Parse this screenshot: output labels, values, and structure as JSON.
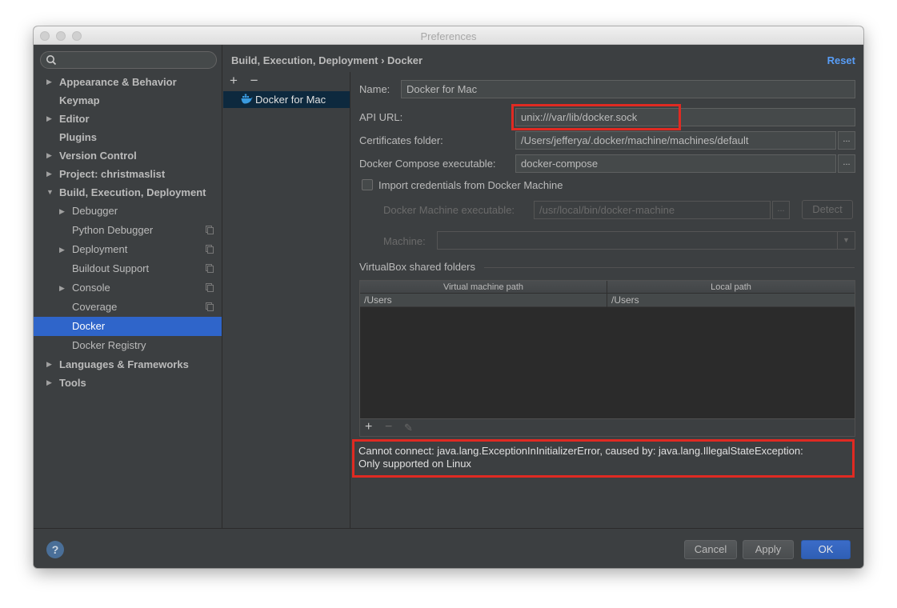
{
  "window": {
    "title": "Preferences"
  },
  "sidebar": {
    "search_placeholder": "",
    "items": [
      {
        "label": "Appearance & Behavior",
        "arrow": "▶",
        "bold": true
      },
      {
        "label": "Keymap",
        "arrow": "",
        "bold": true
      },
      {
        "label": "Editor",
        "arrow": "▶",
        "bold": true
      },
      {
        "label": "Plugins",
        "arrow": "",
        "bold": true
      },
      {
        "label": "Version Control",
        "arrow": "▶",
        "bold": true
      },
      {
        "label": "Project: christmaslist",
        "arrow": "▶",
        "bold": true
      },
      {
        "label": "Build, Execution, Deployment",
        "arrow": "▼",
        "bold": true
      },
      {
        "label": "Debugger",
        "arrow": "▶",
        "bold": false
      },
      {
        "label": "Python Debugger",
        "arrow": "",
        "bold": false
      },
      {
        "label": "Deployment",
        "arrow": "▶",
        "bold": false
      },
      {
        "label": "Buildout Support",
        "arrow": "",
        "bold": false
      },
      {
        "label": "Console",
        "arrow": "▶",
        "bold": false
      },
      {
        "label": "Coverage",
        "arrow": "",
        "bold": false
      },
      {
        "label": "Docker",
        "arrow": "",
        "bold": false
      },
      {
        "label": "Docker Registry",
        "arrow": "",
        "bold": false
      },
      {
        "label": "Languages & Frameworks",
        "arrow": "▶",
        "bold": true
      },
      {
        "label": "Tools",
        "arrow": "▶",
        "bold": true
      }
    ]
  },
  "header": {
    "breadcrumb": "Build, Execution, Deployment › Docker",
    "reset_label": "Reset"
  },
  "list_panel": {
    "add": "+",
    "remove": "−",
    "selected_item": "Docker for Mac"
  },
  "form": {
    "name_label": "Name:",
    "name_value": "Docker for Mac",
    "api_url_label": "API URL:",
    "api_url_value": "unix:///var/lib/docker.sock",
    "certs_label": "Certificates folder:",
    "certs_value": "/Users/jefferya/.docker/machine/machines/default",
    "compose_label": "Docker Compose executable:",
    "compose_value": "docker-compose",
    "browse": "...",
    "import_label": "Import credentials from Docker Machine",
    "dm_exec_label": "Docker Machine executable:",
    "dm_exec_value": "/usr/local/bin/docker-machine",
    "detect_label": "Detect",
    "machine_label": "Machine:",
    "machine_value": ""
  },
  "shared_folders": {
    "title": "VirtualBox shared folders",
    "columns": [
      "Virtual machine path",
      "Local path"
    ],
    "rows": [
      [
        "/Users",
        "/Users"
      ]
    ],
    "add": "+",
    "remove": "−",
    "edit": "✎"
  },
  "error": {
    "line1": "Cannot connect: java.lang.ExceptionInInitializerError, caused by: java.lang.IllegalStateException:",
    "line2": "Only supported on Linux"
  },
  "footer": {
    "help": "?",
    "cancel": "Cancel",
    "apply": "Apply",
    "ok": "OK"
  },
  "colors": {
    "highlight": "#e02a22",
    "selection": "#2f65ca",
    "link": "#589df6"
  }
}
